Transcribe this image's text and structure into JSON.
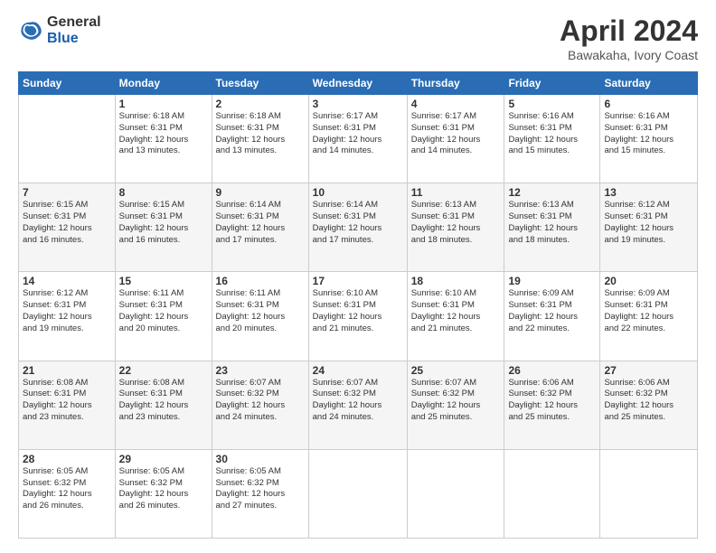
{
  "logo": {
    "general": "General",
    "blue": "Blue"
  },
  "title": "April 2024",
  "subtitle": "Bawakaha, Ivory Coast",
  "headers": [
    "Sunday",
    "Monday",
    "Tuesday",
    "Wednesday",
    "Thursday",
    "Friday",
    "Saturday"
  ],
  "weeks": [
    [
      {
        "day": "",
        "info": ""
      },
      {
        "day": "1",
        "info": "Sunrise: 6:18 AM\nSunset: 6:31 PM\nDaylight: 12 hours\nand 13 minutes."
      },
      {
        "day": "2",
        "info": "Sunrise: 6:18 AM\nSunset: 6:31 PM\nDaylight: 12 hours\nand 13 minutes."
      },
      {
        "day": "3",
        "info": "Sunrise: 6:17 AM\nSunset: 6:31 PM\nDaylight: 12 hours\nand 14 minutes."
      },
      {
        "day": "4",
        "info": "Sunrise: 6:17 AM\nSunset: 6:31 PM\nDaylight: 12 hours\nand 14 minutes."
      },
      {
        "day": "5",
        "info": "Sunrise: 6:16 AM\nSunset: 6:31 PM\nDaylight: 12 hours\nand 15 minutes."
      },
      {
        "day": "6",
        "info": "Sunrise: 6:16 AM\nSunset: 6:31 PM\nDaylight: 12 hours\nand 15 minutes."
      }
    ],
    [
      {
        "day": "7",
        "info": "Sunrise: 6:15 AM\nSunset: 6:31 PM\nDaylight: 12 hours\nand 16 minutes."
      },
      {
        "day": "8",
        "info": "Sunrise: 6:15 AM\nSunset: 6:31 PM\nDaylight: 12 hours\nand 16 minutes."
      },
      {
        "day": "9",
        "info": "Sunrise: 6:14 AM\nSunset: 6:31 PM\nDaylight: 12 hours\nand 17 minutes."
      },
      {
        "day": "10",
        "info": "Sunrise: 6:14 AM\nSunset: 6:31 PM\nDaylight: 12 hours\nand 17 minutes."
      },
      {
        "day": "11",
        "info": "Sunrise: 6:13 AM\nSunset: 6:31 PM\nDaylight: 12 hours\nand 18 minutes."
      },
      {
        "day": "12",
        "info": "Sunrise: 6:13 AM\nSunset: 6:31 PM\nDaylight: 12 hours\nand 18 minutes."
      },
      {
        "day": "13",
        "info": "Sunrise: 6:12 AM\nSunset: 6:31 PM\nDaylight: 12 hours\nand 19 minutes."
      }
    ],
    [
      {
        "day": "14",
        "info": "Sunrise: 6:12 AM\nSunset: 6:31 PM\nDaylight: 12 hours\nand 19 minutes."
      },
      {
        "day": "15",
        "info": "Sunrise: 6:11 AM\nSunset: 6:31 PM\nDaylight: 12 hours\nand 20 minutes."
      },
      {
        "day": "16",
        "info": "Sunrise: 6:11 AM\nSunset: 6:31 PM\nDaylight: 12 hours\nand 20 minutes."
      },
      {
        "day": "17",
        "info": "Sunrise: 6:10 AM\nSunset: 6:31 PM\nDaylight: 12 hours\nand 21 minutes."
      },
      {
        "day": "18",
        "info": "Sunrise: 6:10 AM\nSunset: 6:31 PM\nDaylight: 12 hours\nand 21 minutes."
      },
      {
        "day": "19",
        "info": "Sunrise: 6:09 AM\nSunset: 6:31 PM\nDaylight: 12 hours\nand 22 minutes."
      },
      {
        "day": "20",
        "info": "Sunrise: 6:09 AM\nSunset: 6:31 PM\nDaylight: 12 hours\nand 22 minutes."
      }
    ],
    [
      {
        "day": "21",
        "info": "Sunrise: 6:08 AM\nSunset: 6:31 PM\nDaylight: 12 hours\nand 23 minutes."
      },
      {
        "day": "22",
        "info": "Sunrise: 6:08 AM\nSunset: 6:31 PM\nDaylight: 12 hours\nand 23 minutes."
      },
      {
        "day": "23",
        "info": "Sunrise: 6:07 AM\nSunset: 6:32 PM\nDaylight: 12 hours\nand 24 minutes."
      },
      {
        "day": "24",
        "info": "Sunrise: 6:07 AM\nSunset: 6:32 PM\nDaylight: 12 hours\nand 24 minutes."
      },
      {
        "day": "25",
        "info": "Sunrise: 6:07 AM\nSunset: 6:32 PM\nDaylight: 12 hours\nand 25 minutes."
      },
      {
        "day": "26",
        "info": "Sunrise: 6:06 AM\nSunset: 6:32 PM\nDaylight: 12 hours\nand 25 minutes."
      },
      {
        "day": "27",
        "info": "Sunrise: 6:06 AM\nSunset: 6:32 PM\nDaylight: 12 hours\nand 25 minutes."
      }
    ],
    [
      {
        "day": "28",
        "info": "Sunrise: 6:05 AM\nSunset: 6:32 PM\nDaylight: 12 hours\nand 26 minutes."
      },
      {
        "day": "29",
        "info": "Sunrise: 6:05 AM\nSunset: 6:32 PM\nDaylight: 12 hours\nand 26 minutes."
      },
      {
        "day": "30",
        "info": "Sunrise: 6:05 AM\nSunset: 6:32 PM\nDaylight: 12 hours\nand 27 minutes."
      },
      {
        "day": "",
        "info": ""
      },
      {
        "day": "",
        "info": ""
      },
      {
        "day": "",
        "info": ""
      },
      {
        "day": "",
        "info": ""
      }
    ]
  ]
}
